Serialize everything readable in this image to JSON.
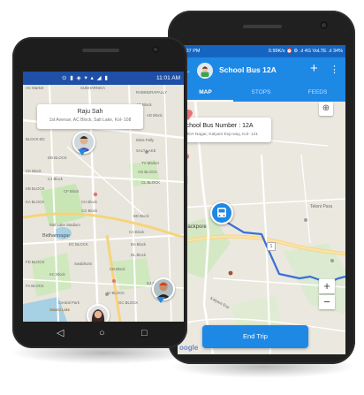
{
  "left_phone": {
    "status_bar": {
      "time": "11:01",
      "time_suffix": "AM"
    },
    "callout": {
      "name": "Raju Sah",
      "address": "1st Avenue, AC Block, Salt Lake, Kol- 108"
    },
    "map_labels": [
      "AC Market",
      "SUBHARNIKA",
      "RABINDRAPALLY",
      "AC Block",
      "AD Block",
      "BLOCK-BC",
      "Mitra Pally",
      "SALT LAKE",
      "DB BLOCK",
      "TV Market",
      "CK Block",
      "AG BLOCK",
      "CJ Block",
      "CL BLOCK",
      "KB BLOCK",
      "CF Block",
      "KA BLOCK",
      "CH Block",
      "CG Block",
      "BD Block",
      "Salt Lake Stadium",
      "Bidhannagar",
      "CA Block",
      "EC BLOCK",
      "BA Block",
      "DL Block",
      "FD BLOCK",
      "Swabhumi",
      "KC Block",
      "CB Block",
      "FA BLOCK",
      "DJ BLOCK",
      "CI BLOCK",
      "GC BLOCK",
      "Central Park",
      "Swasti Lake"
    ],
    "nav": {
      "back": "◁",
      "home": "○",
      "recents": "□"
    }
  },
  "right_phone": {
    "status_bar": {
      "left": "2:37 PM",
      "right": "0.99K/s ⏰ ⚙ .ıl 4G VoLTE .ıl 34%"
    },
    "app_bar": {
      "back_icon": "←",
      "title": "School Bus 12A",
      "add_icon": "+",
      "more_icon": "⋮"
    },
    "tabs": [
      {
        "label": "MAP",
        "active": true
      },
      {
        "label": "STOPS",
        "active": false
      },
      {
        "label": "FEEDS",
        "active": false
      }
    ],
    "info_box": {
      "title": "School Bus Number : 12A",
      "subtitle": "SMDA Nagar, Kalyani Exp-way, Kol- 121"
    },
    "map_labels": [
      "Barrackpore",
      "Teleni Para",
      "Kalyani Exp"
    ],
    "route_badge": "1",
    "zoom_in": "+",
    "zoom_out": "−",
    "google": "oogle",
    "end_trip_button": "End Trip"
  },
  "colors": {
    "primary": "#1e88e5",
    "primary_dark": "#1565c0",
    "route": "#3a6fd8",
    "map_bg": "#ebe8df",
    "road": "#ffffff",
    "highway": "#f8d57a"
  }
}
